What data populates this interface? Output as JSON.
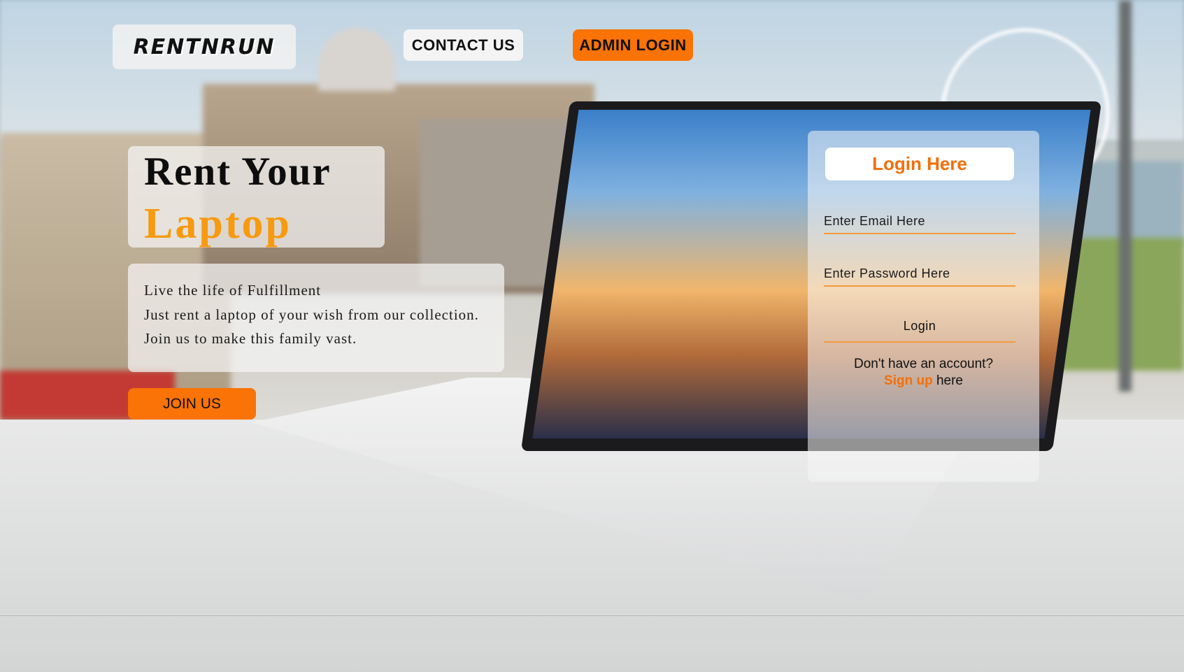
{
  "header": {
    "logo_text": "RENTNRUN",
    "contact_label": "CONTACT US",
    "admin_label": "ADMIN LOGIN"
  },
  "hero": {
    "title_line1": "Rent Your",
    "title_line2": "Laptop",
    "lines": [
      "Live the life of Fulfillment",
      "Just rent a laptop of your wish from our collection.",
      "Join us to make this family vast."
    ],
    "join_label": "JOIN US"
  },
  "login": {
    "title": "Login Here",
    "email_placeholder": "Enter Email Here",
    "password_placeholder": "Enter Password Here",
    "button_label": "Login",
    "signup_prompt": "Don't have an account?",
    "signup_link": "Sign up",
    "signup_suffix": "here"
  },
  "colors": {
    "accent": "#f97306",
    "title_orange": "#f79a0e"
  }
}
